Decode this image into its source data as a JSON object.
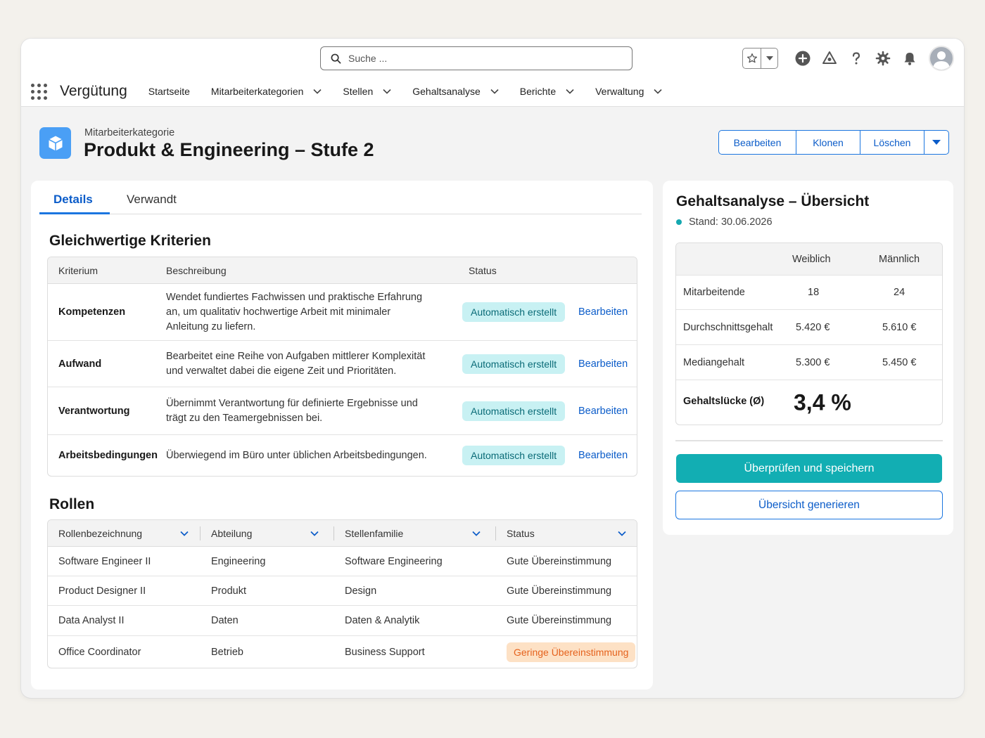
{
  "search": {
    "placeholder": "Suche ..."
  },
  "nav": {
    "app_name": "Vergütung",
    "items": [
      {
        "label": "Startseite",
        "has_menu": false
      },
      {
        "label": "Mitarbeiterkategorien",
        "has_menu": true
      },
      {
        "label": "Stellen",
        "has_menu": true
      },
      {
        "label": "Gehaltsanalyse",
        "has_menu": true
      },
      {
        "label": "Berichte",
        "has_menu": true
      },
      {
        "label": "Verwaltung",
        "has_menu": true
      }
    ]
  },
  "record": {
    "object_label": "Mitarbeiterkategorie",
    "title": "Produkt & Engineering – Stufe 2",
    "actions": [
      "Bearbeiten",
      "Klonen",
      "Löschen"
    ]
  },
  "tabs": [
    "Details",
    "Verwandt"
  ],
  "criteria": {
    "title": "Gleichwertige Kriterien",
    "headers": [
      "Kriterium",
      "Beschreibung",
      "Status"
    ],
    "rows": [
      {
        "name": "Kompetenzen",
        "desc": [
          "Wendet fundiertes Fachwissen und praktische Erfahrung",
          "an, um qualitativ hochwertige Arbeit mit minimaler",
          "Anleitung zu liefern."
        ],
        "status": "Automatisch erstellt",
        "action": "Bearbeiten"
      },
      {
        "name": "Aufwand",
        "desc": [
          "Bearbeitet eine Reihe von Aufgaben mittlerer Komplexität",
          "und verwaltet dabei die eigene Zeit und Prioritäten."
        ],
        "status": "Automatisch erstellt",
        "action": "Bearbeiten"
      },
      {
        "name": "Verantwortung",
        "desc": [
          "Übernimmt Verantwortung für definierte Ergebnisse und",
          "trägt zu den Teamergebnissen bei."
        ],
        "status": "Automatisch erstellt",
        "action": "Bearbeiten"
      },
      {
        "name": "Arbeitsbedingungen",
        "desc": [
          "Überwiegend im Büro unter üblichen Arbeitsbedingungen."
        ],
        "status": "Automatisch erstellt",
        "action": "Bearbeiten"
      }
    ]
  },
  "roles": {
    "title": "Rollen",
    "headers": [
      "Rollenbezeichnung",
      "Abteilung",
      "Stellenfamilie",
      "Status"
    ],
    "rows": [
      {
        "role": "Software Engineer II",
        "dept": "Engineering",
        "family": "Software Engineering",
        "status": "Gute Übereinstimmung",
        "warn": false
      },
      {
        "role": "Product Designer II",
        "dept": "Produkt",
        "family": "Design",
        "status": "Gute Übereinstimmung",
        "warn": false
      },
      {
        "role": "Data Analyst II",
        "dept": "Daten",
        "family": "Daten & Analytik",
        "status": "Gute Übereinstimmung",
        "warn": false
      },
      {
        "role": "Office Coordinator",
        "dept": "Betrieb",
        "family": "Business Support",
        "status": "Geringe Übereinstimmung",
        "warn": true
      }
    ]
  },
  "summary": {
    "title": "Gehaltsanalyse – Übersicht",
    "stand": "Stand: 30.06.2026",
    "columns": [
      "Weiblich",
      "Männlich"
    ],
    "rows": [
      {
        "label": "Mitarbeitende",
        "f": "18",
        "m": "24"
      },
      {
        "label": "Durchschnittsgehalt",
        "f": "5.420 €",
        "m": "5.610 €"
      },
      {
        "label": "Mediangehalt",
        "f": "5.300 €",
        "m": "5.450 €"
      }
    ],
    "gap_label": "Gehaltslücke (Ø)",
    "gap_value": "3,4 %",
    "primary_button": "Überprüfen und speichern",
    "secondary_button": "Übersicht generieren"
  },
  "colors": {
    "accent": "#1b76e0",
    "teal": "#12aeb3",
    "icon_blue": "#4a9ff5",
    "warn_bg": "#fde1c5",
    "ok_bg": "#c8f1f3"
  }
}
